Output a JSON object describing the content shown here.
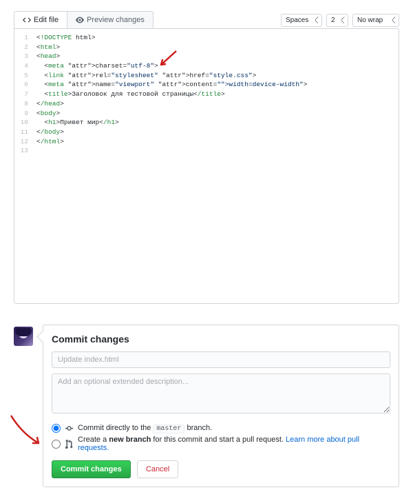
{
  "tabs": {
    "edit": "Edit file",
    "preview": "Preview changes"
  },
  "settings": {
    "indentMode": "Spaces",
    "indentSize": "2",
    "wrap": "No wrap"
  },
  "code": {
    "lines": [
      "<!DOCTYPE html>",
      "<html>",
      "<head>",
      "  <meta charset=\"utf-8\">",
      "  <link rel=\"stylesheet\" href=\"style.css\">",
      "  <meta name=\"viewport\" content=\"width=device-width\">",
      "  <title>Заголовок для тестовой страницы</title>",
      "</head>",
      "<body>",
      "  <h1>Привет мир</h1>",
      "</body>",
      "</html>",
      ""
    ]
  },
  "commit": {
    "heading": "Commit changes",
    "summaryPlaceholder": "Update index.html",
    "descriptionPlaceholder": "Add an optional extended description...",
    "radio1_pre": "Commit directly to the ",
    "radio1_branch": "master",
    "radio1_post": " branch.",
    "radio2_pre": "Create a ",
    "radio2_bold": "new branch",
    "radio2_post": " for this commit and start a pull request. ",
    "radio2_link": "Learn more about pull requests.",
    "commitBtn": "Commit changes",
    "cancelBtn": "Cancel"
  }
}
